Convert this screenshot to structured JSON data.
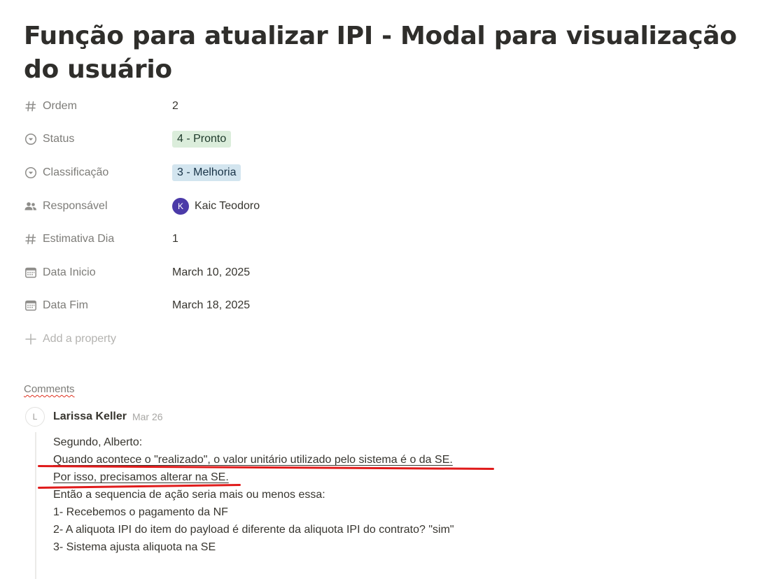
{
  "page": {
    "title": "Função para atualizar IPI  - Modal para visualização do usuário"
  },
  "properties": [
    {
      "icon": "hash-icon",
      "label": "Ordem",
      "value": "2",
      "type": "number"
    },
    {
      "icon": "status-icon",
      "label": "Status",
      "value": "4 - Pronto",
      "type": "tag",
      "tag_bg": "#dbeddb",
      "tag_color": "#1c3829"
    },
    {
      "icon": "select-icon",
      "label": "Classificação",
      "value": "3 - Melhoria",
      "type": "tag",
      "tag_bg": "#d3e5ef",
      "tag_color": "#183347"
    },
    {
      "icon": "people-icon",
      "label": "Responsável",
      "value": "Kaic Teodoro",
      "type": "person",
      "avatar_letter": "K"
    },
    {
      "icon": "hash-icon",
      "label": "Estimativa Dia",
      "value": "1",
      "type": "number"
    },
    {
      "icon": "calendar-icon",
      "label": "Data Inicio",
      "value": "March 10, 2025",
      "type": "date"
    },
    {
      "icon": "calendar-icon",
      "label": "Data Fim",
      "value": "March 18, 2025",
      "type": "date"
    }
  ],
  "add_property_label": "Add a property",
  "comments": {
    "heading": "Comments",
    "items": [
      {
        "avatar_letter": "L",
        "author": "Larissa Keller",
        "date": "Mar 26",
        "lines": [
          "Segundo, Alberto:",
          "Quando acontece o \"realizado\", o valor unitário utilizado pelo sistema é o da SE.",
          "Por isso, precisamos alterar na SE.",
          "Então a sequencia de ação seria mais ou menos essa:",
          "1- Recebemos o pagamento da NF",
          "2- A aliquota IPI do item do payload é diferente da aliquota IPI do contrato? \"sim\"",
          "3- Sistema ajusta aliquota na SE"
        ]
      }
    ]
  },
  "colors": {
    "annotation_red": "#e01b1b",
    "status_tag_bg": "#dbeddb",
    "classification_tag_bg": "#d3e5ef",
    "avatar_bg": "#4b3aa8"
  }
}
